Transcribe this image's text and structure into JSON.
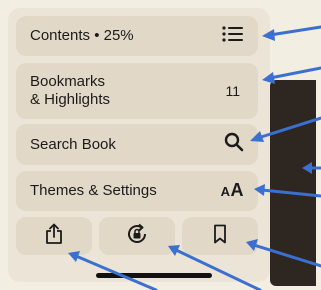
{
  "menu": {
    "contents": {
      "label": "Contents • 25%",
      "icon": "list-icon"
    },
    "bookmarks": {
      "label_line1": "Bookmarks",
      "label_line2": "& Highlights",
      "count": "11"
    },
    "search": {
      "label": "Search Book",
      "icon": "magnifier-icon"
    },
    "themes": {
      "label": "Themes & Settings",
      "glyph_small": "A",
      "glyph_large": "A"
    }
  },
  "actions": {
    "share": {
      "icon": "share-icon"
    },
    "rotation_lock": {
      "icon": "rotation-lock-icon"
    },
    "bookmark": {
      "icon": "bookmark-icon"
    }
  },
  "colors": {
    "background": "#f3eee2",
    "panel": "#ece5d7",
    "button": "#e2d8c7",
    "annotation_arrow": "#3b6fd0",
    "book_dark": "#2e2620"
  }
}
